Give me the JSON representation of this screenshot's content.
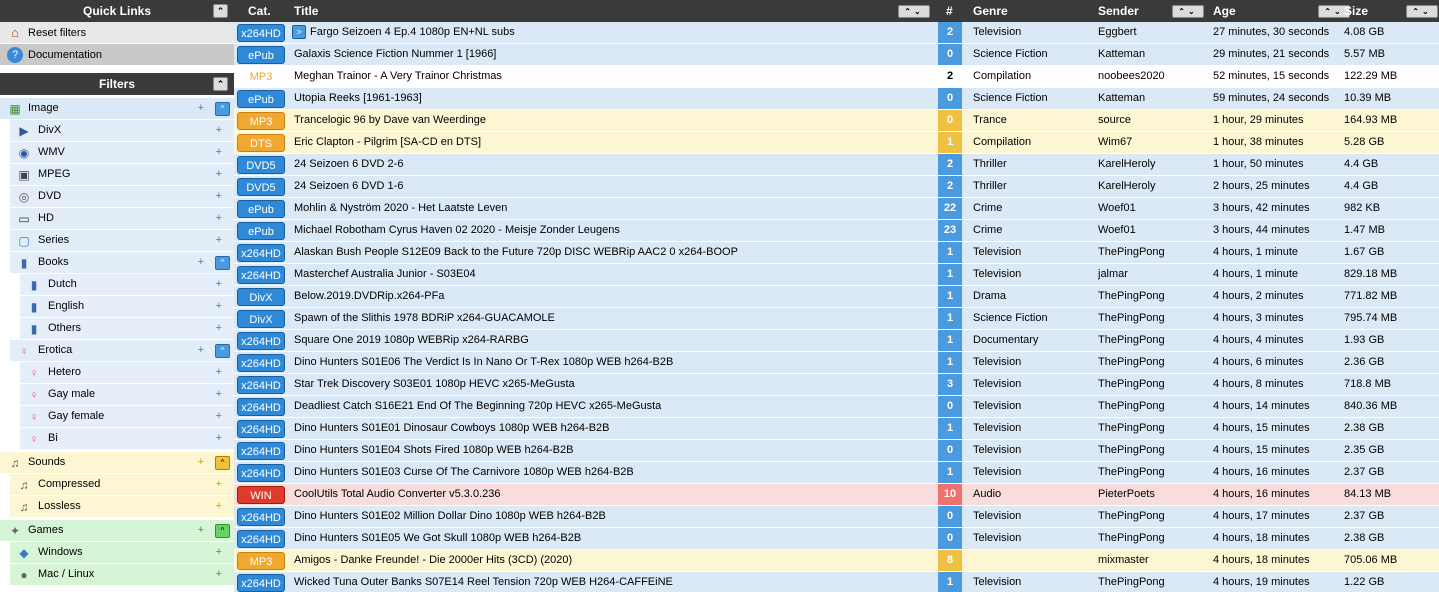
{
  "sidebar": {
    "quick_links_title": "Quick Links",
    "quick_links": [
      {
        "label": "Reset filters",
        "icon": "home-icon"
      },
      {
        "label": "Documentation",
        "icon": "help-icon"
      }
    ],
    "filters_title": "Filters",
    "filters": [
      {
        "label": "Image",
        "icon": "film-icon",
        "level": 0,
        "theme": "blue",
        "plus": "+",
        "toggle": "^"
      },
      {
        "label": "DivX",
        "icon": "divx-icon",
        "level": 1,
        "theme": "blue",
        "plus": "+"
      },
      {
        "label": "WMV",
        "icon": "wmv-icon",
        "level": 1,
        "theme": "blue",
        "plus": "+"
      },
      {
        "label": "MPEG",
        "icon": "mpeg-icon",
        "level": 1,
        "theme": "blue",
        "plus": "+"
      },
      {
        "label": "DVD",
        "icon": "dvd-icon",
        "level": 1,
        "theme": "blue",
        "plus": "+"
      },
      {
        "label": "HD",
        "icon": "hd-icon",
        "level": 1,
        "theme": "blue",
        "plus": "+"
      },
      {
        "label": "Series",
        "icon": "tv-icon",
        "level": 1,
        "theme": "blue",
        "plus": "+"
      },
      {
        "label": "Books",
        "icon": "book-icon",
        "level": 1,
        "theme": "blue",
        "plus": "+",
        "toggle": "^"
      },
      {
        "label": "Dutch",
        "icon": "book-icon",
        "level": 2,
        "theme": "blue",
        "plus": "+"
      },
      {
        "label": "English",
        "icon": "book-icon",
        "level": 2,
        "theme": "blue",
        "plus": "+"
      },
      {
        "label": "Others",
        "icon": "book-icon",
        "level": 2,
        "theme": "blue",
        "plus": "+"
      },
      {
        "label": "Erotica",
        "icon": "venus-icon",
        "level": 1,
        "theme": "blue",
        "plus": "+",
        "toggle": "^"
      },
      {
        "label": "Hetero",
        "icon": "venus-icon",
        "level": 2,
        "theme": "blue",
        "plus": "+"
      },
      {
        "label": "Gay male",
        "icon": "venus-icon",
        "level": 2,
        "theme": "blue",
        "plus": "+"
      },
      {
        "label": "Gay female",
        "icon": "venus-icon",
        "level": 2,
        "theme": "blue",
        "plus": "+"
      },
      {
        "label": "Bi",
        "icon": "venus-icon",
        "level": 2,
        "theme": "blue",
        "plus": "+"
      },
      {
        "label": "Sounds",
        "icon": "music-icon",
        "level": 0,
        "theme": "yel",
        "plus": "+",
        "toggle": "^",
        "gap": true
      },
      {
        "label": "Compressed",
        "icon": "music-icon",
        "level": 1,
        "theme": "yel",
        "plus": "+"
      },
      {
        "label": "Lossless",
        "icon": "music-icon",
        "level": 1,
        "theme": "yel",
        "plus": "+"
      },
      {
        "label": "Games",
        "icon": "gamepad-icon",
        "level": 0,
        "theme": "grn",
        "plus": "+",
        "toggle": "^",
        "gap": true
      },
      {
        "label": "Windows",
        "icon": "windows-icon",
        "level": 1,
        "theme": "grn",
        "plus": "+"
      },
      {
        "label": "Mac / Linux",
        "icon": "apple-icon",
        "level": 1,
        "theme": "grn",
        "plus": "+"
      }
    ]
  },
  "table": {
    "columns": {
      "cat": "Cat.",
      "title": "Title",
      "num": "#",
      "genre": "Genre",
      "sender": "Sender",
      "age": "Age",
      "size": "Size"
    },
    "rows": [
      {
        "cat": "x264HD",
        "cat_style": "blue",
        "play": ">",
        "title": "Fargo Seizoen 4 Ep.4 1080p EN+NL subs",
        "num": "2",
        "genre": "Television",
        "sender": "Eggbert",
        "age": "27 minutes, 30 seconds",
        "size": "4.08 GB",
        "bg": "b"
      },
      {
        "cat": "ePub",
        "cat_style": "blue",
        "title": "Galaxis Science Fiction Nummer 1 [1966]",
        "num": "0",
        "genre": "Science Fiction",
        "sender": "Katteman",
        "age": "29 minutes, 21 seconds",
        "size": "5.57 MB",
        "bg": "b"
      },
      {
        "cat": "MP3",
        "cat_style": "ghost",
        "title": "Meghan Trainor - A Very Trainor Christmas",
        "num": "2",
        "genre": "Compilation",
        "sender": "noobees2020",
        "age": "52 minutes, 15 seconds",
        "size": "122.29 MB",
        "bg": "w"
      },
      {
        "cat": "ePub",
        "cat_style": "blue",
        "title": "Utopia Reeks [1961-1963]",
        "num": "0",
        "genre": "Science Fiction",
        "sender": "Katteman",
        "age": "59 minutes, 24 seconds",
        "size": "10.39 MB",
        "bg": "b"
      },
      {
        "cat": "MP3",
        "cat_style": "orange",
        "title": "Trancelogic 96 by Dave van Weerdinge",
        "num": "0",
        "genre": "Trance",
        "sender": "source",
        "age": "1 hour, 29 minutes",
        "size": "164.93 MB",
        "bg": "y"
      },
      {
        "cat": "DTS",
        "cat_style": "orange",
        "title": "Eric Clapton - Pilgrim [SA-CD en DTS]",
        "num": "1",
        "genre": "Compilation",
        "sender": "Wim67",
        "age": "1 hour, 38 minutes",
        "size": "5.28 GB",
        "bg": "y"
      },
      {
        "cat": "DVD5",
        "cat_style": "blue",
        "title": "24 Seizoen 6 DVD 2-6",
        "num": "2",
        "genre": "Thriller",
        "sender": "KarelHeroly",
        "age": "1 hour, 50 minutes",
        "size": "4.4 GB",
        "bg": "b"
      },
      {
        "cat": "DVD5",
        "cat_style": "blue",
        "title": "24 Seizoen 6 DVD 1-6",
        "num": "2",
        "genre": "Thriller",
        "sender": "KarelHeroly",
        "age": "2 hours, 25 minutes",
        "size": "4.4 GB",
        "bg": "b"
      },
      {
        "cat": "ePub",
        "cat_style": "blue",
        "title": "Mohlin & Nyström 2020 - Het Laatste Leven",
        "num": "22",
        "genre": "Crime",
        "sender": "Woef01",
        "age": "3 hours, 42 minutes",
        "size": "982 KB",
        "bg": "b"
      },
      {
        "cat": "ePub",
        "cat_style": "blue",
        "title": "Michael Robotham Cyrus Haven 02 2020 - Meisje Zonder Leugens",
        "num": "23",
        "genre": "Crime",
        "sender": "Woef01",
        "age": "3 hours, 44 minutes",
        "size": "1.47 MB",
        "bg": "b"
      },
      {
        "cat": "x264HD",
        "cat_style": "blue",
        "title": "Alaskan Bush People S12E09 Back to the Future 720p DISC WEBRip AAC2 0 x264-BOOP",
        "num": "1",
        "genre": "Television",
        "sender": "ThePingPong",
        "age": "4 hours, 1 minute",
        "size": "1.67 GB",
        "bg": "b"
      },
      {
        "cat": "x264HD",
        "cat_style": "blue",
        "title": "Masterchef Australia Junior - S03E04",
        "num": "1",
        "genre": "Television",
        "sender": "jalmar",
        "age": "4 hours, 1 minute",
        "size": "829.18 MB",
        "bg": "b"
      },
      {
        "cat": "DivX",
        "cat_style": "blue",
        "title": "Below.2019.DVDRip.x264-PFa",
        "num": "1",
        "genre": "Drama",
        "sender": "ThePingPong",
        "age": "4 hours, 2 minutes",
        "size": "771.82 MB",
        "bg": "b"
      },
      {
        "cat": "DivX",
        "cat_style": "blue",
        "title": "Spawn of the Slithis 1978 BDRiP x264-GUACAMOLE",
        "num": "1",
        "genre": "Science Fiction",
        "sender": "ThePingPong",
        "age": "4 hours, 3 minutes",
        "size": "795.74 MB",
        "bg": "b"
      },
      {
        "cat": "x264HD",
        "cat_style": "blue",
        "title": "Square One 2019 1080p WEBRip x264-RARBG",
        "num": "1",
        "genre": "Documentary",
        "sender": "ThePingPong",
        "age": "4 hours, 4 minutes",
        "size": "1.93 GB",
        "bg": "b"
      },
      {
        "cat": "x264HD",
        "cat_style": "blue",
        "title": "Dino Hunters S01E06 The Verdict Is In Nano Or T-Rex 1080p WEB h264-B2B",
        "num": "1",
        "genre": "Television",
        "sender": "ThePingPong",
        "age": "4 hours, 6 minutes",
        "size": "2.36 GB",
        "bg": "b"
      },
      {
        "cat": "x264HD",
        "cat_style": "blue",
        "title": "Star Trek Discovery S03E01 1080p HEVC x265-MeGusta",
        "num": "3",
        "genre": "Television",
        "sender": "ThePingPong",
        "age": "4 hours, 8 minutes",
        "size": "718.8 MB",
        "bg": "b"
      },
      {
        "cat": "x264HD",
        "cat_style": "blue",
        "title": "Deadliest Catch S16E21 End Of The Beginning 720p HEVC x265-MeGusta",
        "num": "0",
        "genre": "Television",
        "sender": "ThePingPong",
        "age": "4 hours, 14 minutes",
        "size": "840.36 MB",
        "bg": "b"
      },
      {
        "cat": "x264HD",
        "cat_style": "blue",
        "title": "Dino Hunters S01E01 Dinosaur Cowboys 1080p WEB h264-B2B",
        "num": "1",
        "genre": "Television",
        "sender": "ThePingPong",
        "age": "4 hours, 15 minutes",
        "size": "2.38 GB",
        "bg": "b"
      },
      {
        "cat": "x264HD",
        "cat_style": "blue",
        "title": "Dino Hunters S01E04 Shots Fired 1080p WEB h264-B2B",
        "num": "0",
        "genre": "Television",
        "sender": "ThePingPong",
        "age": "4 hours, 15 minutes",
        "size": "2.35 GB",
        "bg": "b"
      },
      {
        "cat": "x264HD",
        "cat_style": "blue",
        "title": "Dino Hunters S01E03 Curse Of The Carnivore 1080p WEB h264-B2B",
        "num": "1",
        "genre": "Television",
        "sender": "ThePingPong",
        "age": "4 hours, 16 minutes",
        "size": "2.37 GB",
        "bg": "b"
      },
      {
        "cat": "WIN",
        "cat_style": "red",
        "title": "CoolUtils Total Audio Converter v5.3.0.236",
        "num": "10",
        "genre": "Audio",
        "sender": "PieterPoets",
        "age": "4 hours, 16 minutes",
        "size": "84.13 MB",
        "bg": "r"
      },
      {
        "cat": "x264HD",
        "cat_style": "blue",
        "title": "Dino Hunters S01E02 Million Dollar Dino 1080p WEB h264-B2B",
        "num": "0",
        "genre": "Television",
        "sender": "ThePingPong",
        "age": "4 hours, 17 minutes",
        "size": "2.37 GB",
        "bg": "b"
      },
      {
        "cat": "x264HD",
        "cat_style": "blue",
        "title": "Dino Hunters S01E05 We Got Skull 1080p WEB h264-B2B",
        "num": "0",
        "genre": "Television",
        "sender": "ThePingPong",
        "age": "4 hours, 18 minutes",
        "size": "2.38 GB",
        "bg": "b"
      },
      {
        "cat": "MP3",
        "cat_style": "orange",
        "title": "Amigos - Danke Freunde! - Die 2000er Hits (3CD) (2020)",
        "num": "8",
        "genre": "",
        "sender": "mixmaster",
        "age": "4 hours, 18 minutes",
        "size": "705.06 MB",
        "bg": "y"
      },
      {
        "cat": "x264HD",
        "cat_style": "blue",
        "title": "Wicked Tuna Outer Banks S07E14 Reel Tension 720p WEB H264-CAFFEiNE",
        "num": "1",
        "genre": "Television",
        "sender": "ThePingPong",
        "age": "4 hours, 19 minutes",
        "size": "1.22 GB",
        "bg": "b"
      }
    ]
  },
  "sort_glyphs": {
    "pair": "⌃⌄",
    "single": "⌃"
  }
}
